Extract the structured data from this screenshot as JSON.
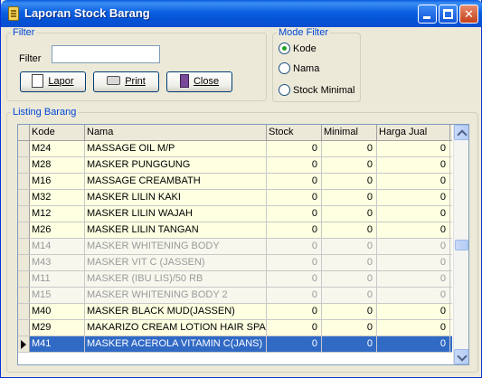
{
  "window": {
    "title": "Laporan Stock Barang"
  },
  "filter_group": {
    "legend": "Filter",
    "label": "Filter",
    "value": "",
    "buttons": {
      "lapor": "Lapor",
      "print": "Print",
      "close": "Close"
    }
  },
  "mode_group": {
    "legend": "Mode Filter",
    "options": [
      "Kode",
      "Nama",
      "Stock Minimal"
    ],
    "selected": "Kode"
  },
  "listing_group": {
    "legend": "Listing Barang",
    "columns": [
      "Kode",
      "Nama",
      "Stock",
      "Minimal",
      "Harga Jual"
    ],
    "rows": [
      [
        "M24",
        "MASSAGE OIL M/P",
        "0",
        "0",
        "0"
      ],
      [
        "M28",
        "MASKER PUNGGUNG",
        "0",
        "0",
        "0"
      ],
      [
        "M16",
        "MASSAGE CREAMBATH",
        "0",
        "0",
        "0"
      ],
      [
        "M32",
        "MASKER LILIN KAKI",
        "0",
        "0",
        "0"
      ],
      [
        "M12",
        "MASKER LILIN WAJAH",
        "0",
        "0",
        "0"
      ],
      [
        "M26",
        "MASKER LILIN TANGAN",
        "0",
        "0",
        "0"
      ],
      [
        "M14",
        "MASKER WHITENING BODY",
        "0",
        "0",
        "0"
      ],
      [
        "M43",
        "MASKER VIT C (JASSEN)",
        "0",
        "0",
        "0"
      ],
      [
        "M11",
        "MASKER (IBU LIS)/50 RB",
        "0",
        "0",
        "0"
      ],
      [
        "M15",
        "MASKER WHITENING BODY 2",
        "0",
        "0",
        "0"
      ],
      [
        "M40",
        "MASKER BLACK MUD(JASSEN)",
        "0",
        "0",
        "0"
      ],
      [
        "M29",
        "MAKARIZO CREAM LOTION HAIR SPA",
        "0",
        "0",
        "0"
      ],
      [
        "M41",
        "MASKER ACEROLA VITAMIN C(JANS)",
        "0",
        "0",
        "0"
      ]
    ]
  }
}
